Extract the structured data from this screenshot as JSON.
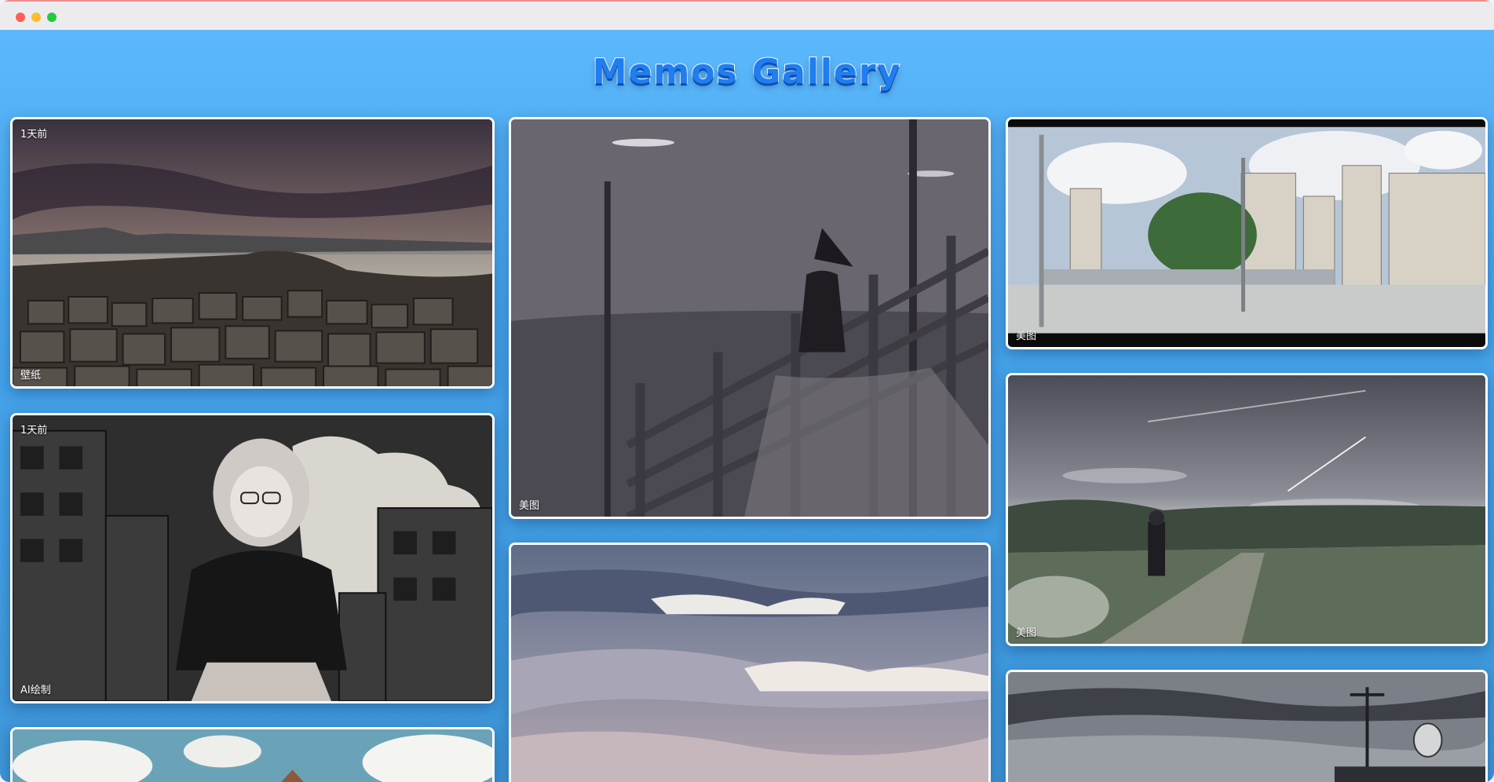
{
  "window": {
    "controls": [
      "close",
      "minimize",
      "zoom"
    ]
  },
  "header": {
    "title": "Memos Gallery"
  },
  "cards": [
    {
      "scene": "coastal-rocks-sunset",
      "time": "1天前",
      "category": "壁纸"
    },
    {
      "scene": "anime-girl-hoodie-city",
      "time": "1天前",
      "category": "AI绘制"
    },
    {
      "scene": "clouds-sky-partial",
      "time": "",
      "category": ""
    },
    {
      "scene": "witch-on-stairs",
      "time": "",
      "category": "美图"
    },
    {
      "scene": "dusk-clouds",
      "time": "",
      "category": ""
    },
    {
      "scene": "anime-street-day",
      "time": "",
      "category": "美图"
    },
    {
      "scene": "girl-starry-field",
      "time": "",
      "category": "美图"
    },
    {
      "scene": "rooftop-antenna-sky",
      "time": "",
      "category": ""
    }
  ]
}
